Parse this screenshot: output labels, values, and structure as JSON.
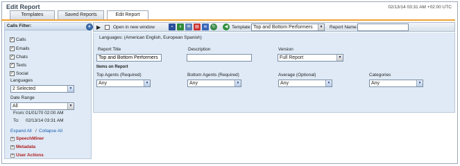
{
  "app": {
    "title": "Edit Report",
    "timestamp": "02/13/14 03:31 AM +02:00 UTC"
  },
  "tabs": [
    {
      "label": "Templates"
    },
    {
      "label": "Saved Reports"
    },
    {
      "label": "Edit Report"
    }
  ],
  "sidebar": {
    "header": "Calls Filter:",
    "collapse_symbol": "«",
    "channels": [
      {
        "label": "Calls",
        "checked": true
      },
      {
        "label": "Emails",
        "checked": true
      },
      {
        "label": "Chats",
        "checked": true
      },
      {
        "label": "Texts",
        "checked": true
      },
      {
        "label": "Social",
        "checked": true
      }
    ],
    "languages_label": "Languages",
    "languages_value": "2 Selected",
    "date_range_label": "Date Range",
    "date_range_value": "All",
    "from_label": "From:",
    "from_value": "01/01/70 02:00 AM",
    "to_label": "To:",
    "to_value": "02/13/14 03:31 AM",
    "expand_all": "Expand All",
    "separator": "/",
    "collapse_all": "Collapse All",
    "tree": [
      {
        "label": "SpeechMiner"
      },
      {
        "label": "Metadata"
      },
      {
        "label": "User Actions"
      }
    ]
  },
  "toolbar": {
    "run_icon": "play-icon",
    "open_new_window_label": "Open in new window",
    "open_new_window_checked": false,
    "icons": [
      "save-icon",
      "export-excel-icon",
      "email-icon",
      "export-pdf-icon",
      "export-word-icon",
      "refresh-icon"
    ],
    "template_label": "Template:",
    "template_value": "Top and Bottom Performers",
    "report_name_label": "Report Name:",
    "report_name_value": ""
  },
  "form": {
    "languages_line": "Languages: (American English, European Spanish)",
    "report_title_label": "Report Title",
    "report_title_value": "Top and Bottom Performers",
    "description_label": "Description",
    "description_value": "",
    "version_label": "Version",
    "version_value": "Full Report",
    "items_header": "Items on Report",
    "items": [
      {
        "label": "Top Agents (Required)",
        "value": "Any"
      },
      {
        "label": "Bottom Agents (Required)",
        "value": "Any"
      },
      {
        "label": "Average (Optional)",
        "value": "Any"
      },
      {
        "label": "Categories",
        "value": "Any"
      }
    ]
  },
  "colors": {
    "accent_tab_line": "#f0a030",
    "panel_bg": "#dfeaf6",
    "link": "#1d5fb0",
    "tree_text": "#b02020"
  }
}
